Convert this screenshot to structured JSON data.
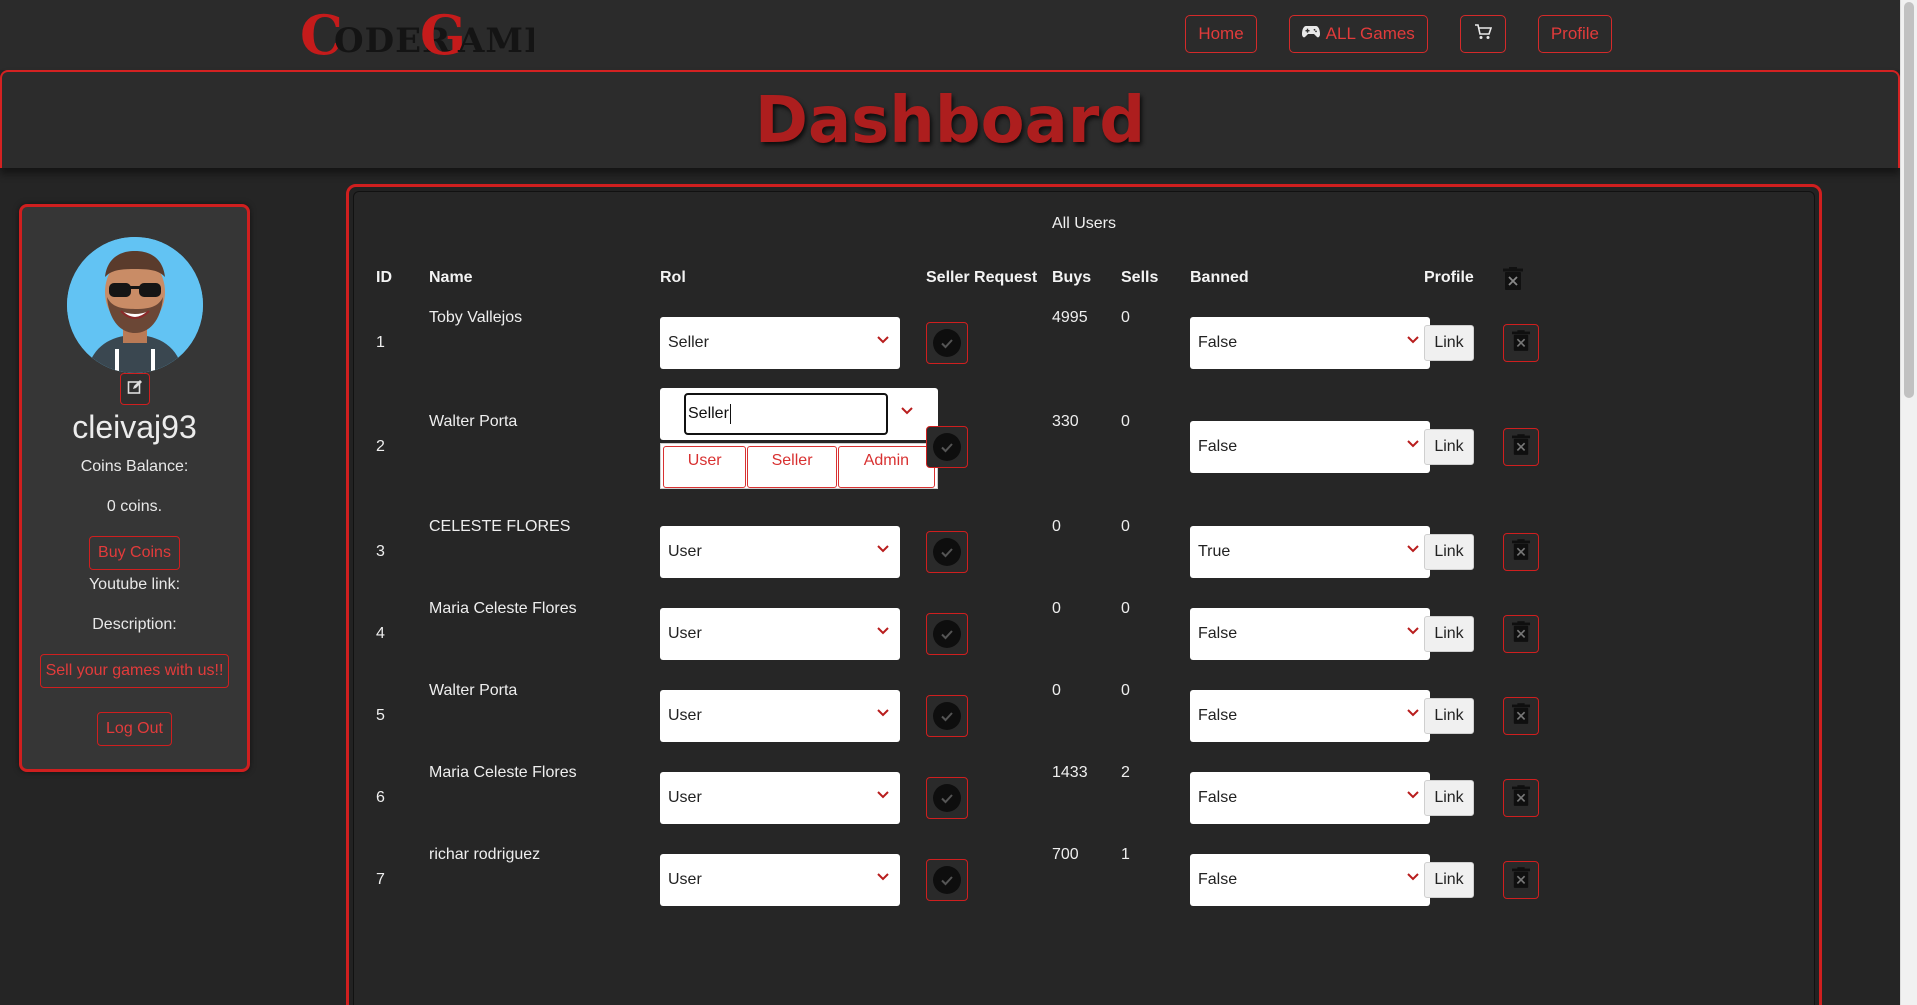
{
  "brand": {
    "logo_text": "CoderGame"
  },
  "nav": {
    "home": "Home",
    "all_games": "ALL Games",
    "all_games_icon": "gamepad-icon",
    "cart_icon": "cart-icon",
    "profile": "Profile"
  },
  "header": {
    "title": "Dashboard"
  },
  "profile": {
    "username": "cleivaj93",
    "coins_label": "Coins Balance:",
    "coins_value": "0 coins.",
    "buy_coins": "Buy Coins",
    "youtube_label": "Youtube link:",
    "description_label": "Description:",
    "sell_button": "Sell your games with us!!",
    "logout": "Log Out"
  },
  "table": {
    "caption": "All Users",
    "headers": {
      "id": "ID",
      "name": "Name",
      "rol": "Rol",
      "seller_request": "Seller Request",
      "buys": "Buys",
      "sells": "Sells",
      "banned": "Banned",
      "profile": "Profile"
    },
    "link_label": "Link",
    "rows": [
      {
        "id": "1",
        "name": "Toby Vallejos",
        "rol": "Seller",
        "buys": "4995",
        "sells": "0",
        "banned": "False"
      },
      {
        "id": "2",
        "name": "Walter Porta",
        "rol": "Seller",
        "buys": "330",
        "sells": "0",
        "banned": "False"
      },
      {
        "id": "3",
        "name": "CELESTE FLORES",
        "rol": "User",
        "buys": "0",
        "sells": "0",
        "banned": "True"
      },
      {
        "id": "4",
        "name": "Maria Celeste Flores",
        "rol": "User",
        "buys": "0",
        "sells": "0",
        "banned": "False"
      },
      {
        "id": "5",
        "name": "Walter Porta",
        "rol": "User",
        "buys": "0",
        "sells": "0",
        "banned": "False"
      },
      {
        "id": "6",
        "name": "Maria Celeste Flores",
        "rol": "User",
        "buys": "1433",
        "sells": "2",
        "banned": "False"
      },
      {
        "id": "7",
        "name": "richar rodriguez",
        "rol": "User",
        "buys": "700",
        "sells": "1",
        "banned": "False"
      }
    ],
    "rol_options": [
      "User",
      "Seller",
      "Admin"
    ]
  },
  "colors": {
    "accent": "#d42a2a",
    "title": "#ad1e1e",
    "background": "#252525"
  }
}
